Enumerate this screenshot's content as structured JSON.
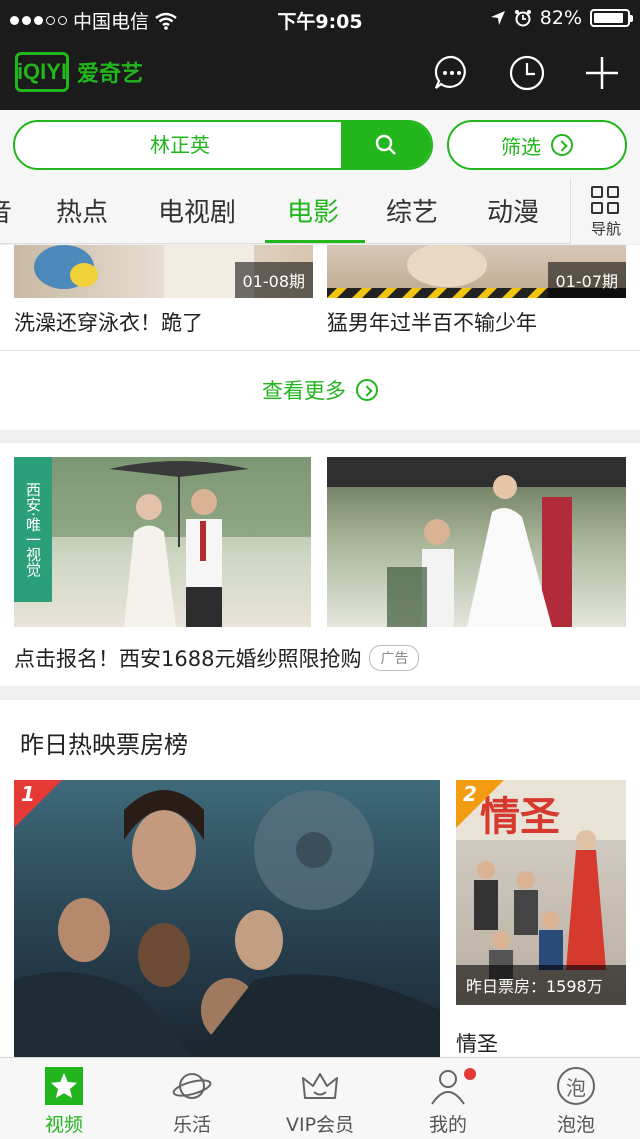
{
  "status_bar": {
    "carrier": "中国电信",
    "time": "下午9:05",
    "battery": "82%"
  },
  "header": {
    "logo_mark": "iQIYI",
    "logo_text": "爱奇艺",
    "icons": [
      "chat-icon",
      "history-clock-icon",
      "plus-icon"
    ]
  },
  "search": {
    "query": "林正英",
    "filter_label": "筛选"
  },
  "tabs": {
    "items": [
      "音",
      "热点",
      "电视剧",
      "电影",
      "综艺",
      "动漫"
    ],
    "active": "电影",
    "nav_label": "导航"
  },
  "top_videos": [
    {
      "episode": "01-08期",
      "title": "洗澡还穿泳衣！跪了"
    },
    {
      "episode": "01-07期",
      "title": "猛男年过半百不输少年"
    }
  ],
  "see_more": "查看更多",
  "ad": {
    "side_tag": "西安·唯一视觉",
    "text": "点击报名！西安1688元婚纱照限抢购",
    "badge": "广告"
  },
  "box_office": {
    "title": "昨日热映票房榜",
    "items": [
      {
        "rank": "1",
        "title": ""
      },
      {
        "rank": "2",
        "title": "情圣",
        "boxoffice": "昨日票房：1598万",
        "poster_text": "情圣"
      }
    ]
  },
  "bottom_nav": {
    "items": [
      {
        "label": "视频",
        "icon": "star-icon",
        "active": true
      },
      {
        "label": "乐活",
        "icon": "planet-icon"
      },
      {
        "label": "VIP会员",
        "icon": "crown-icon"
      },
      {
        "label": "我的",
        "icon": "user-icon",
        "badge_dot": true
      },
      {
        "label": "泡泡",
        "icon": "bubble-icon",
        "icon_text": "泡"
      }
    ]
  },
  "colors": {
    "brand_green": "#22b51c",
    "header_bg": "#1b1b1b",
    "rank1": "#e53935",
    "rank2": "#f39c12"
  }
}
